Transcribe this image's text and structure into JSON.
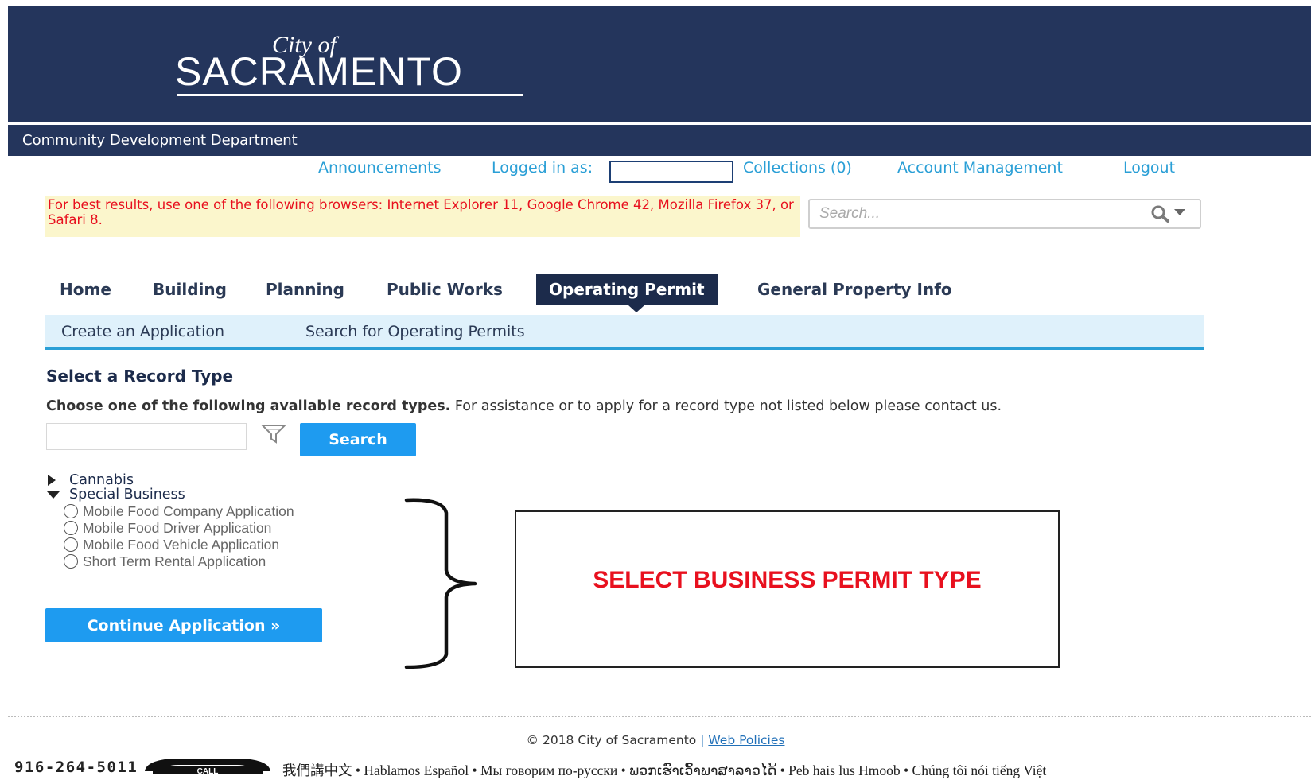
{
  "header": {
    "logo_small": "City of",
    "logo_big": "SACRAMENTO",
    "department": "Community Development Department"
  },
  "top_links": {
    "announcements": "Announcements",
    "logged_in_as": "Logged in as:",
    "collections": "Collections (0)",
    "account_management": "Account Management",
    "logout": "Logout"
  },
  "browser_warning": "For best results, use one of the following browsers: Internet Explorer 11, Google Chrome 42, Mozilla Firefox 37, or Safari 8.",
  "global_search": {
    "placeholder": "Search..."
  },
  "nav": {
    "tabs": [
      "Home",
      "Building",
      "Planning",
      "Public Works",
      "Operating Permit",
      "General Property Info"
    ],
    "active": "Operating Permit"
  },
  "subnav": {
    "items": [
      "Create an Application",
      "Search for Operating Permits"
    ]
  },
  "record_type": {
    "title": "Select a Record Type",
    "instructions_bold": "Choose one of the following available record types.",
    "instructions_rest": " For assistance or to apply for a record type not listed below please contact us.",
    "search_button": "Search",
    "tree": [
      {
        "label": "Cannabis",
        "expanded": false
      },
      {
        "label": "Special Business",
        "expanded": true,
        "options": [
          "Mobile Food Company Application",
          "Mobile Food Driver Application",
          "Mobile Food Vehicle Application",
          "Short Term Rental Application"
        ]
      }
    ],
    "continue_button": "Continue Application »"
  },
  "annotation": {
    "callout": "SELECT BUSINESS PERMIT TYPE",
    "color": "#e8101e"
  },
  "footer": {
    "copyright": "© 2018 City of Sacramento",
    "separator": "|",
    "web_policies": "Web Policies",
    "phone": "916-264-5011",
    "phone_icon_label": "CALL",
    "languages": "我們講中文 • Hablamos Español • Мы говорим по-русски • ພວກເຮົາເວົ້າພາສາລາວໄດ້ • Peb hais lus Hmoob • Chúng tôi nói tiếng Việt"
  },
  "colors": {
    "header_bg": "#24355c",
    "link": "#2a9fd6",
    "button": "#1e9bf0",
    "warning_bg": "#fbf6cc",
    "warning_text": "#e8101e"
  }
}
